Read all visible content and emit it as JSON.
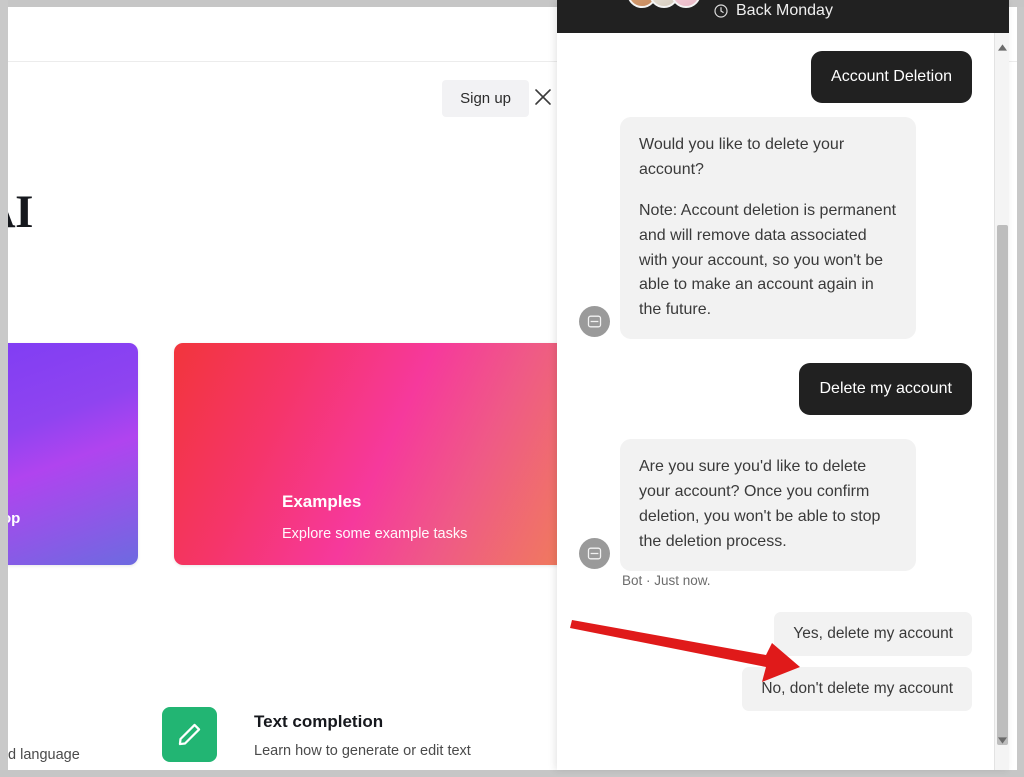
{
  "background_page": {
    "signup_label": "Sign up",
    "close_icon": "close-icon",
    "heading": "nAI",
    "cards": [
      {
        "title": "op",
        "subtitle": "",
        "color": "#8f44f0",
        "icon": ""
      },
      {
        "title": "Examples",
        "subtitle": "Explore some example tasks",
        "color": "#f5356a",
        "icon": ""
      }
    ],
    "lower_section": {
      "caption": "d language",
      "tile_icon": "pencil-icon",
      "tile_color": "#22b573",
      "title": "Text completion",
      "subtitle": "Learn how to generate or edit text"
    }
  },
  "chat": {
    "header": {
      "status_text": "Back Monday",
      "clock_icon": "clock-icon",
      "avatar_count": 3
    },
    "messages": [
      {
        "sender": "user",
        "type": "dark",
        "text": "Account Deletion"
      },
      {
        "sender": "bot",
        "type": "light",
        "avatar_icon": "bot-icon",
        "paragraphs": [
          "Would you like to delete your account?",
          "Note: Account deletion is permanent and will remove data associated with your account, so you won't be able to make an account again in the future."
        ]
      },
      {
        "sender": "user",
        "type": "dark",
        "text": "Delete my account"
      },
      {
        "sender": "bot",
        "type": "light",
        "avatar_icon": "bot-icon",
        "paragraphs": [
          "Are you sure you'd like to delete your account? Once you confirm deletion, you won't be able to stop the deletion process."
        ],
        "meta": "Bot · Just now."
      }
    ],
    "quick_replies": [
      {
        "label": "Yes, delete my account",
        "highlighted": true
      },
      {
        "label": "No, don't delete my account",
        "highlighted": false
      }
    ],
    "scrollbar": {
      "up_icon": "scroll-up-arrow-icon",
      "down_icon": "scroll-down-arrow-icon"
    }
  },
  "annotation": {
    "arrow_color": "#e01a1a",
    "points_to": "Yes, delete my account"
  },
  "colors": {
    "dark_bubble": "#212121",
    "light_bubble": "#f2f2f2",
    "accent_green": "#22b573",
    "annotation_red": "#e01a1a"
  }
}
